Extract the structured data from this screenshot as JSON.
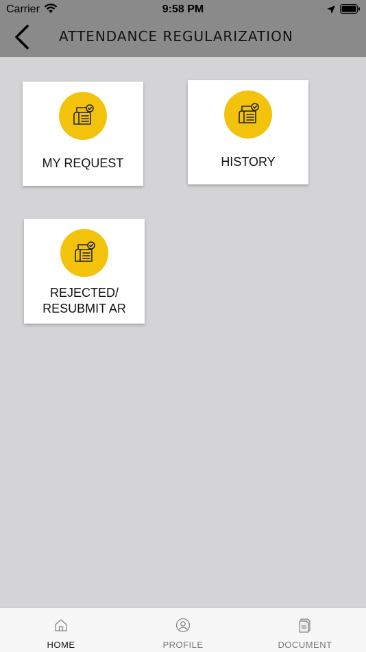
{
  "status": {
    "carrier": "Carrier",
    "time": "9:58 PM"
  },
  "header": {
    "title": "ATTENDANCE REGULARIZATION"
  },
  "tiles": [
    {
      "label": "MY REQUEST"
    },
    {
      "label": "HISTORY"
    },
    {
      "label": "REJECTED/\nRESUBMIT AR"
    }
  ],
  "tabbar": {
    "items": [
      {
        "label": "HOME",
        "icon": "home-icon"
      },
      {
        "label": "PROFILE",
        "icon": "profile-icon"
      },
      {
        "label": "DOCUMENT",
        "icon": "document-icon"
      }
    ]
  },
  "colors": {
    "accent": "#f3c20b",
    "header_bg": "#8a8a8a",
    "page_bg": "#d4d3d5"
  }
}
